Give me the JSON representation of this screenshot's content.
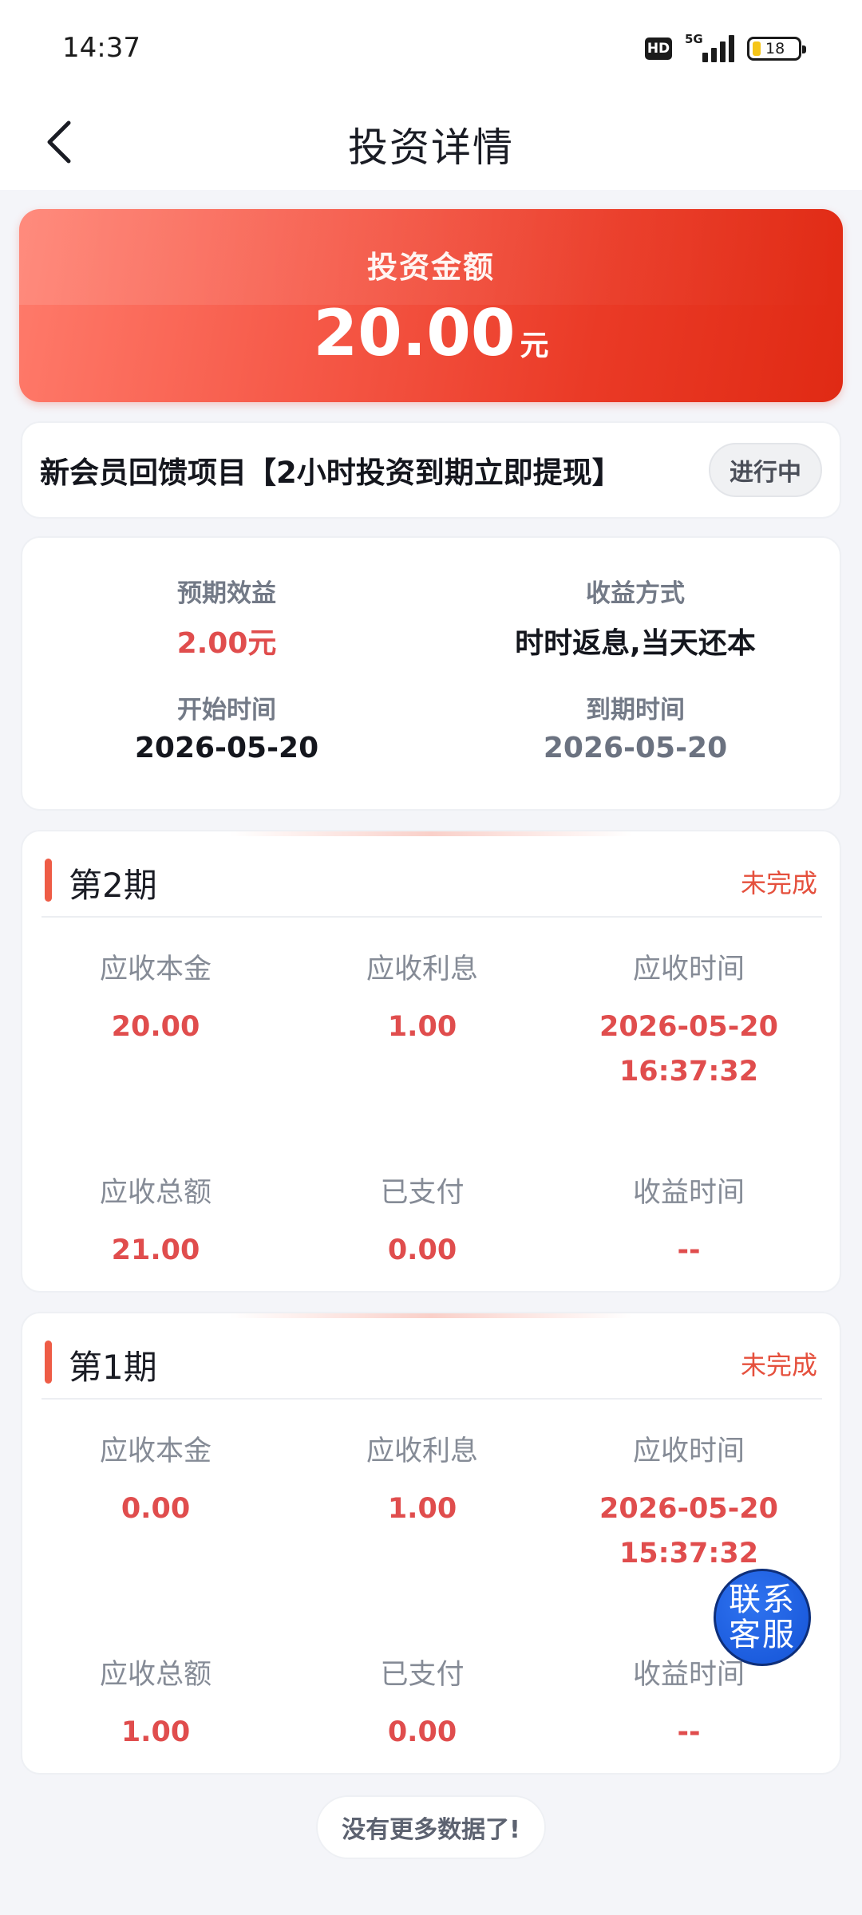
{
  "status_bar": {
    "time": "14:37",
    "hd": "HD",
    "network": "5G",
    "battery": "18"
  },
  "nav": {
    "title": "投资详情"
  },
  "hero": {
    "label": "投资金额",
    "amount": "20.00",
    "unit": "元"
  },
  "project": {
    "name": "新会员回馈项目【2小时投资到期立即提现】",
    "status": "进行中"
  },
  "info": {
    "expected_return_label": "预期效益",
    "expected_return": "2.00元",
    "return_method_label": "收益方式",
    "return_method": "时时返息,当天还本",
    "start_label": "开始时间",
    "start": "2026-05-20",
    "end_label": "到期时间",
    "end": "2026-05-20"
  },
  "periods": [
    {
      "title": "第2期",
      "status": "未完成",
      "principal_label": "应收本金",
      "principal": "20.00",
      "interest_label": "应收利息",
      "interest": "1.00",
      "due_label": "应收时间",
      "due_date": "2026-05-20",
      "due_time": "16:37:32",
      "total_label": "应收总额",
      "total": "21.00",
      "paid_label": "已支付",
      "paid": "0.00",
      "income_time_label": "收益时间",
      "income_time": "--"
    },
    {
      "title": "第1期",
      "status": "未完成",
      "principal_label": "应收本金",
      "principal": "0.00",
      "interest_label": "应收利息",
      "interest": "1.00",
      "due_label": "应收时间",
      "due_date": "2026-05-20",
      "due_time": "15:37:32",
      "total_label": "应收总额",
      "total": "1.00",
      "paid_label": "已支付",
      "paid": "0.00",
      "income_time_label": "收益时间",
      "income_time": "--"
    }
  ],
  "footer": {
    "no_more": "没有更多数据了!"
  },
  "support": {
    "line1": "联系",
    "line2": "客服"
  },
  "colors": {
    "accent_red": "#e04d4d",
    "hero_start": "#ff7b6b",
    "hero_end": "#e02a14",
    "support_blue": "#1453d6"
  },
  "icons": {
    "back": "chevron-left-icon"
  }
}
